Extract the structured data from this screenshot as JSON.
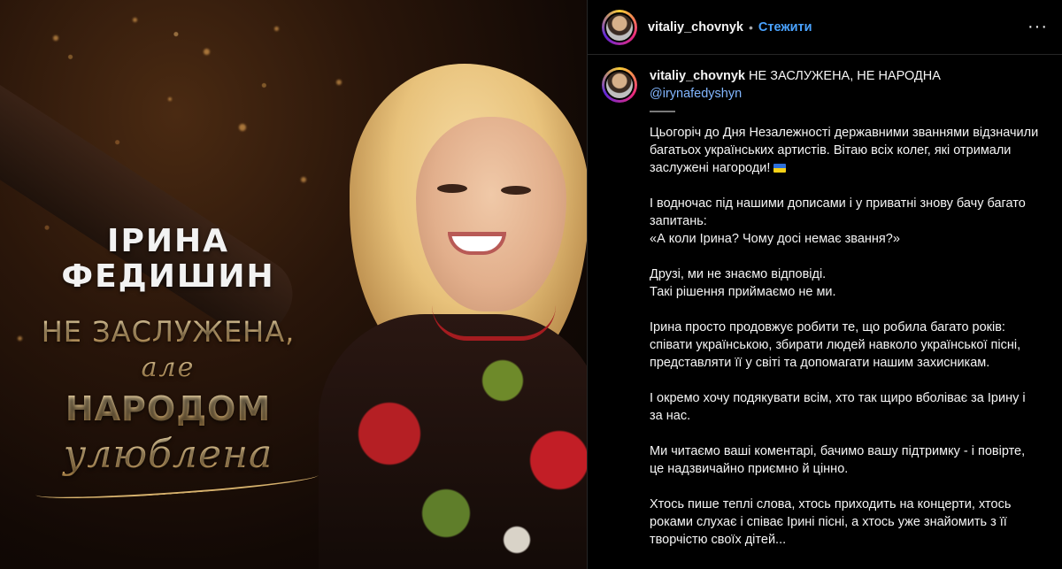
{
  "poster": {
    "name_line1": "ІРИНА",
    "name_line2": "ФЕДИШИН",
    "phrase_line1": "НЕ ЗАСЛУЖЕНА,",
    "phrase_line2": "але",
    "phrase_line3": "НАРОДОМ",
    "phrase_line4": "улюблена"
  },
  "header": {
    "username": "vitaliy_chovnyk",
    "separator": "•",
    "follow_label": "Стежити",
    "more_icon": "more-horizontal-icon",
    "more_glyph": "···"
  },
  "caption": {
    "username": "vitaliy_chovnyk",
    "title": "НЕ ЗАСЛУЖЕНА, НЕ НАРОДНА",
    "mention": "@irynafedyshyn",
    "divider": "——",
    "paragraphs": [
      "Цьогоріч до Дня Незалежності державними званнями відзначили багатьох українських артистів. Вітаю всіх колег, які отримали заслужені нагороди!",
      "І водночас під нашими дописами і у приватні знову бачу багато запитань:\n«А коли Ірина? Чому досі немає звання?»",
      "Друзі, ми не знаємо відповіді.\nТакі рішення приймаємо не ми.",
      "Ірина просто продовжує робити те, що робила багато років: співати українською, збирати людей навколо української пісні, представляти її у світі та допомагати нашим захисникам.",
      "І окремо хочу подякувати всім, хто так щиро вболіває за Ірину і за нас.",
      "Ми читаємо ваші коментарі, бачимо вашу підтримку - і повірте, це надзвичайно приємно й цінно.",
      "Хтось пише теплі слова, хтось приходить на концерти, хтось роками слухає і співає Ірині пісні, а хтось уже знайомить з її творчістю своїх дітей..."
    ],
    "flag_icon": "ukraine-flag-icon"
  },
  "colors": {
    "background": "#000000",
    "text": "#f5f5f5",
    "link": "#4aa3ff",
    "gold": "#e9c88a"
  }
}
